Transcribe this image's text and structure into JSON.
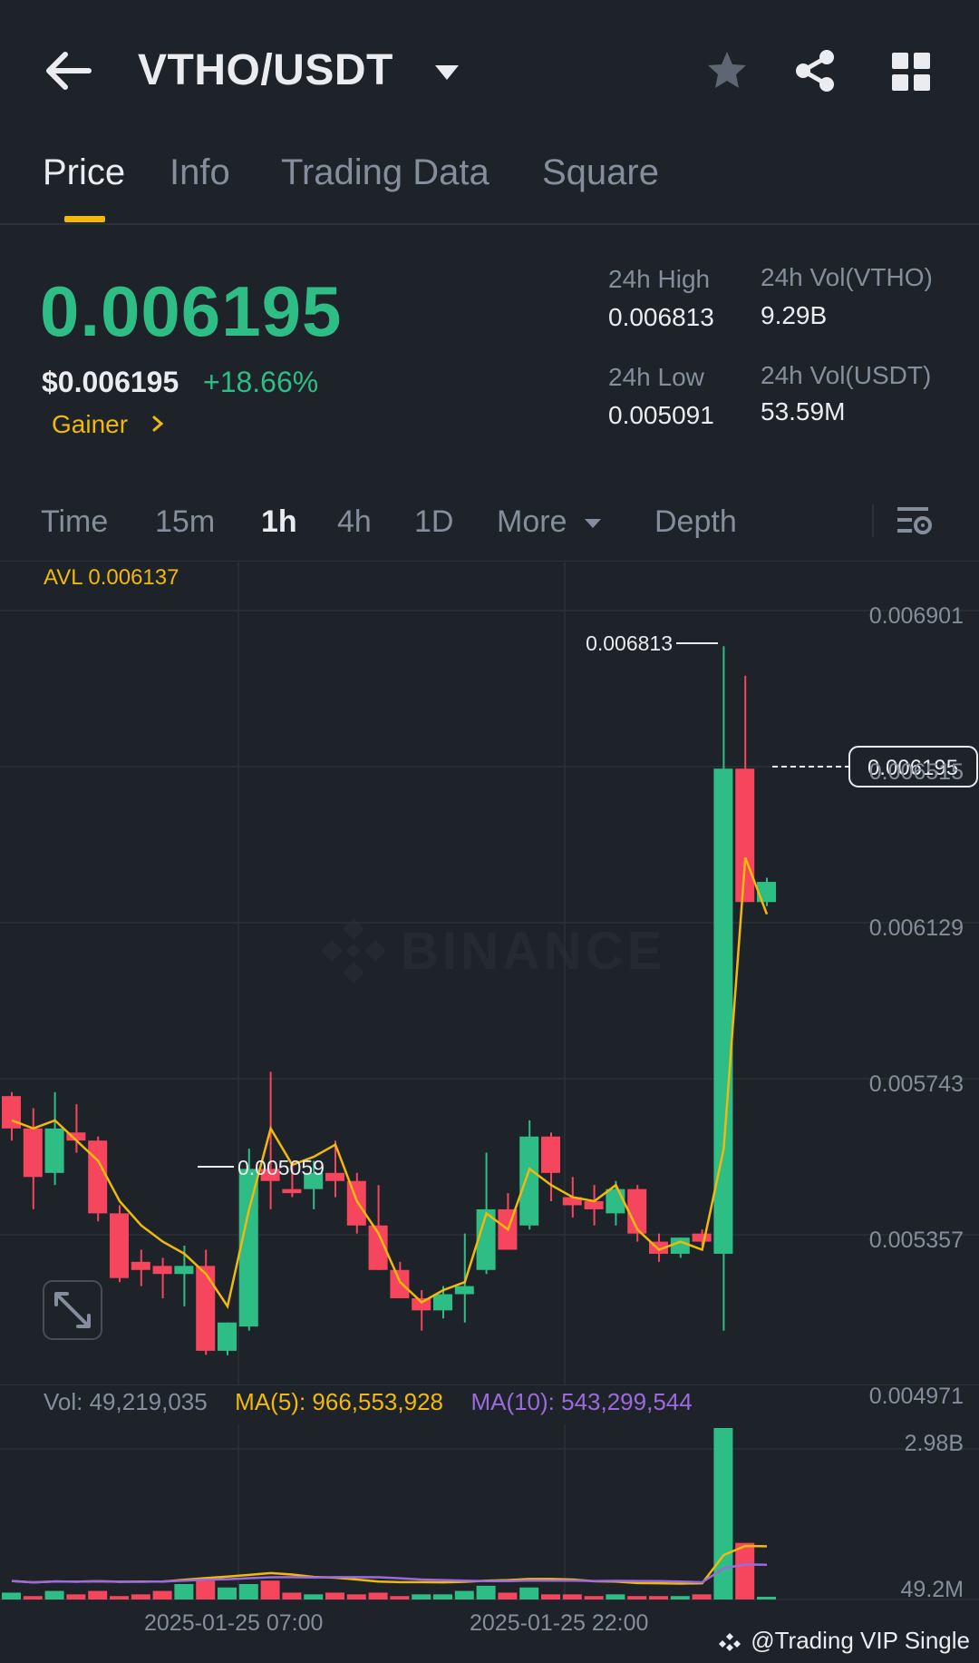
{
  "header": {
    "pair": "VTHO/USDT"
  },
  "tabs": [
    "Price",
    "Info",
    "Trading Data",
    "Square"
  ],
  "ticker": {
    "last_price": "0.006195",
    "usd_price": "$0.006195",
    "change": "+18.66%",
    "tag": "Gainer",
    "high_label": "24h High",
    "high_value": "0.006813",
    "low_label": "24h Low",
    "low_value": "0.005091",
    "vol_base_label": "24h Vol(VTHO)",
    "vol_base_value": "9.29B",
    "vol_quote_label": "24h Vol(USDT)",
    "vol_quote_value": "53.59M"
  },
  "intervals": {
    "items": [
      "Time",
      "15m",
      "1h",
      "4h",
      "1D"
    ],
    "active": "1h",
    "more": "More",
    "depth": "Depth"
  },
  "chart_labels": {
    "avl": "AVL 0.006137",
    "watermark": "BINANCE",
    "high_marker": "0.006813",
    "low_marker": "0.005059",
    "current_price": "0.006195"
  },
  "volume_legend": {
    "vol": "Vol: 49,219,035",
    "ma5": "MA(5): 966,553,928",
    "ma10": "MA(10): 543,299,544"
  },
  "footer": {
    "credit": "@Trading VIP Single"
  },
  "colors": {
    "up": "#2ebd85",
    "down": "#f6465d",
    "accent": "#f0b90b",
    "ma10": "#9c6ade",
    "bg": "#1e2329"
  },
  "icons": [
    "back-arrow-icon",
    "dropdown-caret-icon",
    "star-icon",
    "share-icon",
    "grid-menu-icon",
    "chart-settings-icon",
    "expand-icon",
    "binance-logo-icon"
  ],
  "chart_data": {
    "type": "candlestick",
    "interval": "1h",
    "price_axis": [
      "0.006901",
      "0.006515",
      "0.006129",
      "0.005743",
      "0.005357",
      "0.004971"
    ],
    "ylim": [
      0.004971,
      0.006901
    ],
    "x_ticks": [
      "2025-01-25 07:00",
      "2025-01-25 22:00"
    ],
    "candles": [
      {
        "o": 0.0057,
        "h": 0.00571,
        "l": 0.00559,
        "c": 0.00562
      },
      {
        "o": 0.00562,
        "h": 0.00567,
        "l": 0.00542,
        "c": 0.0055
      },
      {
        "o": 0.00551,
        "h": 0.00571,
        "l": 0.00548,
        "c": 0.00562
      },
      {
        "o": 0.00561,
        "h": 0.00568,
        "l": 0.00556,
        "c": 0.00559
      },
      {
        "o": 0.00559,
        "h": 0.0056,
        "l": 0.00539,
        "c": 0.00541
      },
      {
        "o": 0.00541,
        "h": 0.00543,
        "l": 0.00524,
        "c": 0.00525
      },
      {
        "o": 0.00529,
        "h": 0.00532,
        "l": 0.00523,
        "c": 0.00527
      },
      {
        "o": 0.00528,
        "h": 0.0053,
        "l": 0.0052,
        "c": 0.00526
      },
      {
        "o": 0.00526,
        "h": 0.00533,
        "l": 0.00518,
        "c": 0.00528
      },
      {
        "o": 0.00528,
        "h": 0.00532,
        "l": 0.00506,
        "c": 0.00507
      },
      {
        "o": 0.00507,
        "h": 0.00514,
        "l": 0.005059,
        "c": 0.00514
      },
      {
        "o": 0.00513,
        "h": 0.00557,
        "l": 0.00512,
        "c": 0.00552
      },
      {
        "o": 0.00552,
        "h": 0.00576,
        "l": 0.00542,
        "c": 0.00549
      },
      {
        "o": 0.00547,
        "h": 0.00553,
        "l": 0.00545,
        "c": 0.00546
      },
      {
        "o": 0.00547,
        "h": 0.00554,
        "l": 0.00542,
        "c": 0.00551
      },
      {
        "o": 0.00551,
        "h": 0.00559,
        "l": 0.00545,
        "c": 0.00549
      },
      {
        "o": 0.00549,
        "h": 0.00551,
        "l": 0.00536,
        "c": 0.00538
      },
      {
        "o": 0.00538,
        "h": 0.00548,
        "l": 0.00527,
        "c": 0.00527
      },
      {
        "o": 0.00527,
        "h": 0.00529,
        "l": 0.0052,
        "c": 0.0052
      },
      {
        "o": 0.0052,
        "h": 0.00522,
        "l": 0.00512,
        "c": 0.00517
      },
      {
        "o": 0.00517,
        "h": 0.00523,
        "l": 0.00515,
        "c": 0.00521
      },
      {
        "o": 0.00521,
        "h": 0.00536,
        "l": 0.00514,
        "c": 0.00523
      },
      {
        "o": 0.00527,
        "h": 0.00556,
        "l": 0.00526,
        "c": 0.00542
      },
      {
        "o": 0.00542,
        "h": 0.00546,
        "l": 0.00532,
        "c": 0.00532
      },
      {
        "o": 0.00538,
        "h": 0.00564,
        "l": 0.00537,
        "c": 0.0056
      },
      {
        "o": 0.0056,
        "h": 0.00561,
        "l": 0.00544,
        "c": 0.00551
      },
      {
        "o": 0.00545,
        "h": 0.0055,
        "l": 0.0054,
        "c": 0.00543
      },
      {
        "o": 0.00544,
        "h": 0.00548,
        "l": 0.00538,
        "c": 0.00542
      },
      {
        "o": 0.00541,
        "h": 0.00549,
        "l": 0.00538,
        "c": 0.00547
      },
      {
        "o": 0.00547,
        "h": 0.00548,
        "l": 0.00534,
        "c": 0.00536
      },
      {
        "o": 0.00534,
        "h": 0.00536,
        "l": 0.00529,
        "c": 0.00531
      },
      {
        "o": 0.00531,
        "h": 0.00535,
        "l": 0.0053,
        "c": 0.00535
      },
      {
        "o": 0.00536,
        "h": 0.00537,
        "l": 0.00533,
        "c": 0.00534
      },
      {
        "o": 0.00531,
        "h": 0.006813,
        "l": 0.00512,
        "c": 0.00651
      },
      {
        "o": 0.00651,
        "h": 0.00674,
        "l": 0.00618,
        "c": 0.00618
      },
      {
        "o": 0.00618,
        "h": 0.00624,
        "l": 0.00617,
        "c": 0.00623
      }
    ],
    "ma_line": [
      0.00564,
      0.00562,
      0.00564,
      0.00559,
      0.00554,
      0.00544,
      0.00538,
      0.00534,
      0.00531,
      0.00526,
      0.00518,
      0.00542,
      0.00562,
      0.00553,
      0.00555,
      0.00558,
      0.00544,
      0.00536,
      0.00524,
      0.00519,
      0.00522,
      0.00524,
      0.00541,
      0.00537,
      0.00552,
      0.00548,
      0.00545,
      0.00544,
      0.00548,
      0.00537,
      0.00532,
      0.00534,
      0.00532,
      0.00557,
      0.00629,
      0.00615
    ],
    "volume": {
      "ylabels": [
        "2.98B",
        "49.2M"
      ],
      "values": [
        0.04,
        0.02,
        0.05,
        0.03,
        0.05,
        0.02,
        0.03,
        0.05,
        0.09,
        0.11,
        0.07,
        0.09,
        0.11,
        0.04,
        0.03,
        0.04,
        0.03,
        0.04,
        0.02,
        0.03,
        0.03,
        0.05,
        0.08,
        0.04,
        0.07,
        0.03,
        0.03,
        0.02,
        0.03,
        0.02,
        0.02,
        0.02,
        0.03,
        1.0,
        0.33,
        0.008
      ],
      "up": [
        true,
        false,
        true,
        false,
        false,
        false,
        false,
        false,
        true,
        false,
        true,
        true,
        false,
        false,
        true,
        false,
        false,
        false,
        false,
        true,
        true,
        true,
        true,
        false,
        true,
        false,
        false,
        false,
        true,
        false,
        false,
        true,
        false,
        true,
        false,
        true
      ]
    }
  }
}
